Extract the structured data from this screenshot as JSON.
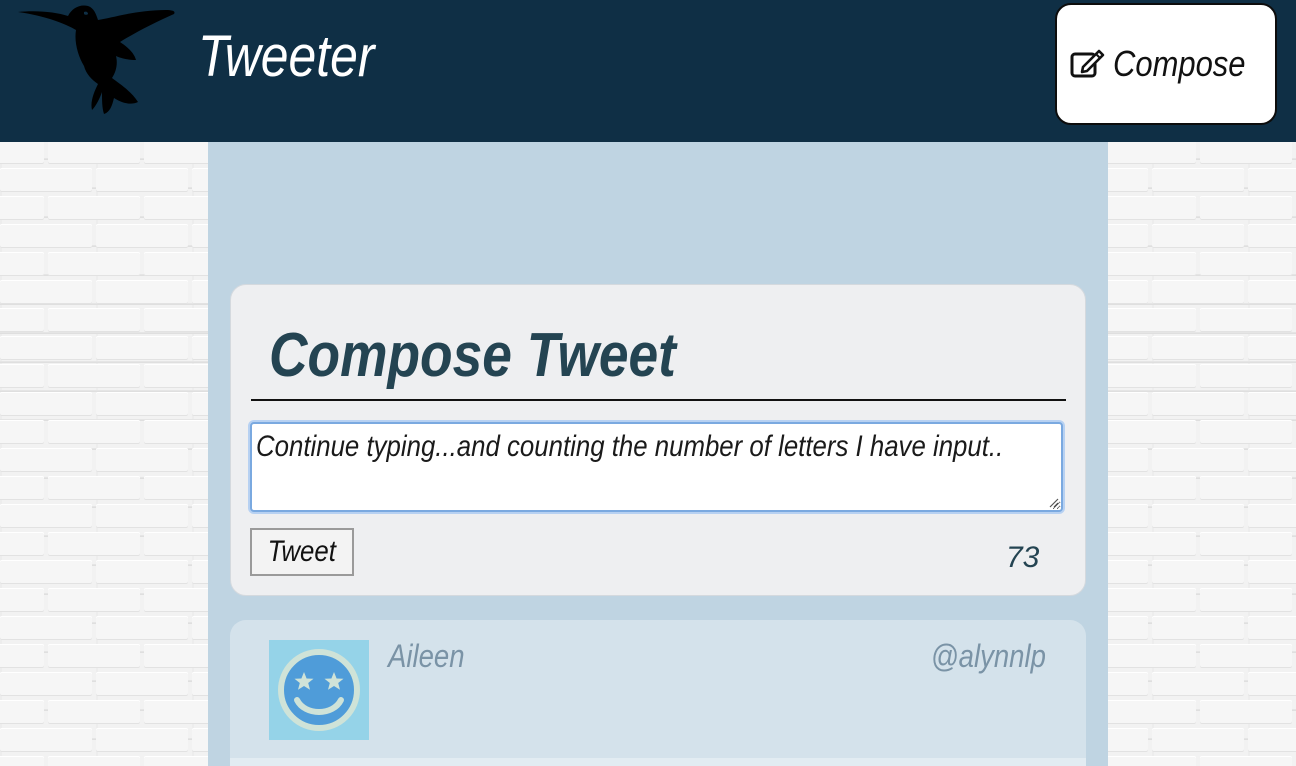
{
  "header": {
    "app_title": "Tweeter",
    "logo_icon": "hummingbird-icon",
    "compose_label": "Compose",
    "compose_icon": "edit-square-icon"
  },
  "new_tweet": {
    "heading": "Compose Tweet",
    "input_value": "Continue typing...and counting the number of letters I have input..",
    "submit_label": "Tweet",
    "char_counter": "73"
  },
  "tweets": [
    {
      "author": "Aileen",
      "handle": "@alynnlp",
      "avatar_icon": "smiley-star-eyes-icon"
    }
  ],
  "colors": {
    "nav_bg": "#0f2f45",
    "main_bg": "#bfd4e2",
    "heading": "#244452",
    "input_focus": "#7aa9e0",
    "tweet_bg": "#d4e2eb",
    "tweet_meta": "#7a93a6"
  }
}
